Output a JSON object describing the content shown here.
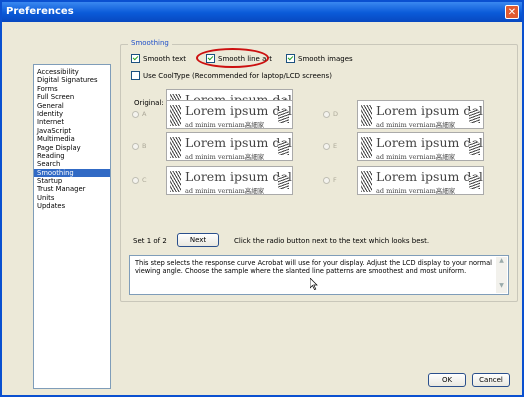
{
  "window": {
    "title": "Preferences",
    "close_symbol": "✕"
  },
  "categories": [
    {
      "label": "Accessibility"
    },
    {
      "label": "Digital Signatures"
    },
    {
      "label": "Forms"
    },
    {
      "label": "Full Screen"
    },
    {
      "label": "General"
    },
    {
      "label": "Identity"
    },
    {
      "label": "Internet"
    },
    {
      "label": "JavaScript"
    },
    {
      "label": "Multimedia"
    },
    {
      "label": "Page Display"
    },
    {
      "label": "Reading"
    },
    {
      "label": "Search"
    },
    {
      "label": "Smoothing",
      "selected": true
    },
    {
      "label": "Startup"
    },
    {
      "label": "Trust Manager"
    },
    {
      "label": "Units"
    },
    {
      "label": "Updates"
    }
  ],
  "smoothing": {
    "group_title": "Smoothing",
    "smooth_text": {
      "label": "Smooth text",
      "checked": true
    },
    "smooth_line_art": {
      "label": "Smooth line art",
      "checked": true
    },
    "smooth_images": {
      "label": "Smooth images",
      "checked": true
    },
    "cooltype": {
      "label": "Use CoolType (Recommended for laptop/LCD screens)",
      "checked": false
    },
    "original_label": "Original:",
    "sample_line1": "Lorem ipsum dolor",
    "sample_line2": "ad minim verniam",
    "sample_cjk": "高細家",
    "options": [
      {
        "letter": "A"
      },
      {
        "letter": "B"
      },
      {
        "letter": "C"
      },
      {
        "letter": "D"
      },
      {
        "letter": "E"
      },
      {
        "letter": "F"
      }
    ],
    "set_label": "Set 1 of 2",
    "next_button": "Next",
    "instruction": "Click the radio button next to the text which looks best.",
    "description": "This step selects the response curve Acrobat will use for your display. Adjust the LCD display to your normal viewing angle. Choose the sample where the slanted line patterns are smoothest and most uniform."
  },
  "footer": {
    "ok_button": "OK",
    "cancel_button": "Cancel"
  },
  "colors": {
    "title_bar": "#0a5ad8",
    "selection": "#316ac5",
    "highlight_ring": "#cc1010",
    "group_title": "#2050c8"
  }
}
